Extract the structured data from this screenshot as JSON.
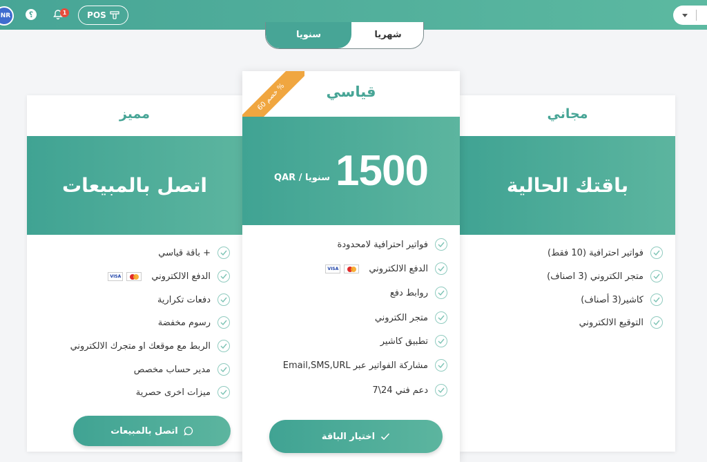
{
  "topbar": {
    "avatar_initials": "NR",
    "help_glyph": "؟",
    "notification_count": "1",
    "pos_label": "POS"
  },
  "period_toggle": {
    "yearly": "سنويا",
    "monthly": "شهريا"
  },
  "plans": {
    "premium": {
      "title": "مميز",
      "band": "اتصل بالمبيعات",
      "features": [
        "+ باقة قياسي",
        "الدفع الالكتروني",
        "دفعات تكرارية",
        "رسوم مخفضة",
        "الربط مع موقعك او متجرك الالكتروني",
        "مدير حساب مخصص",
        "ميزات اخرى حصرية"
      ],
      "button": "اتصل بالمبيعات"
    },
    "standard": {
      "title": "قياسي",
      "ribbon": "خصم 60 %",
      "price": "1500",
      "unit": "QAR / سنويا",
      "features": [
        "فواتير احترافية لامحدودة",
        "الدفع الالكتروني",
        "روابط دفع",
        "متجر الكتروني",
        "تطبيق كاشير",
        "مشاركة الفواتير عبر Email,SMS,URL",
        "دعم فني 24\\7"
      ],
      "button": "اختيار الباقة"
    },
    "free": {
      "title": "مجاني",
      "band": "باقتك الحالية",
      "features": [
        "فواتير احترافية (10 فقط)",
        "متجر الكتروني (3 اصناف)",
        "كاشير(3 أصناف)",
        "التوقيع الالكتروني"
      ]
    }
  },
  "payment_icons": [
    "visa-icon",
    "mastercard-icon"
  ],
  "colors": {
    "accent": "#47a596",
    "ribbon": "#f0a640",
    "badge": "#e74c3c"
  }
}
